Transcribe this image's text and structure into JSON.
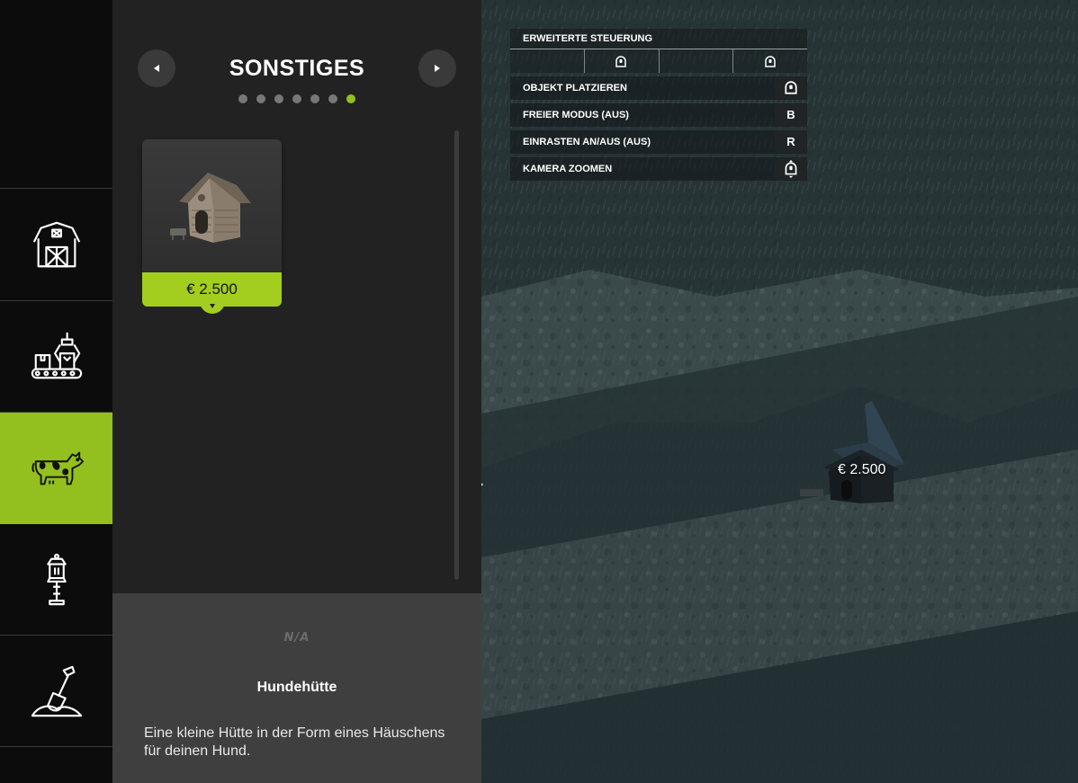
{
  "rail": {
    "categories": [
      {
        "id": "buildings",
        "icon": "barn-icon",
        "active": false
      },
      {
        "id": "production",
        "icon": "factory-icon",
        "active": false
      },
      {
        "id": "animals",
        "icon": "cow-icon",
        "active": true
      },
      {
        "id": "decoration",
        "icon": "lamp-icon",
        "active": false
      },
      {
        "id": "landscaping",
        "icon": "shovel-icon",
        "active": false
      }
    ]
  },
  "panel": {
    "title": "SONSTIGES",
    "page_count": 7,
    "active_page": 7,
    "items": [
      {
        "name": "Hundehütte",
        "price": "€ 2.500",
        "icon": "doghouse-icon"
      }
    ]
  },
  "details": {
    "na_label": "N/A",
    "name": "Hundehütte",
    "description": "Eine kleine Hütte in der Form eines Häuschens für deinen Hund."
  },
  "help": {
    "title": "ERWEITERTE STEUERUNG",
    "rows": [
      {
        "label": "OBJEKT PLATZIEREN",
        "key": "",
        "key_icon": "mouse-left-icon"
      },
      {
        "label": "FREIER MODUS (AUS)",
        "key": "B",
        "key_icon": ""
      },
      {
        "label": "EINRASTEN AN/AUS (AUS)",
        "key": "R",
        "key_icon": ""
      },
      {
        "label": "KAMERA ZOOMEN",
        "key": "",
        "key_icon": "mouse-wheel-icon"
      }
    ]
  },
  "world": {
    "placement_price": "€ 2.500"
  },
  "colors": {
    "accent": "#93c01f",
    "price_bg": "#a4ce1f",
    "panel_bg": "#232223",
    "details_bg": "#403f40"
  }
}
